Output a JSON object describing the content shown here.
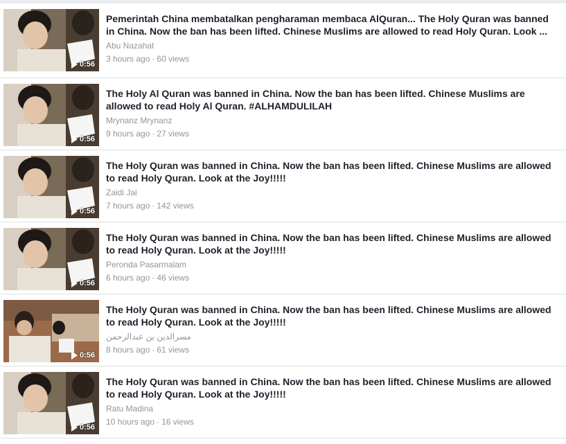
{
  "videos": [
    {
      "title": "Pemerintah China membatalkan pengharaman membaca AlQuran... The Holy Quran was banned in China. Now the ban has been lifted. Chinese Muslims are allowed to read Holy Quran. Look ...",
      "author": "Abu Nazahat",
      "time": "3 hours ago",
      "views": "60 views",
      "duration": "0:56",
      "thumb_variant": "a"
    },
    {
      "title": "The Holy Al Quran was banned in China. Now the ban has been lifted. Chinese Muslims are allowed to read Holy Al Quran. #ALHAMDULILAH",
      "author": "Mrynanz Mrynanz",
      "time": "9 hours ago",
      "views": "27 views",
      "duration": "0:56",
      "thumb_variant": "a"
    },
    {
      "title": "The Holy Quran was banned in China. Now the ban has been lifted. Chinese Muslims are allowed to read Holy Quran. Look at the Joy!!!!!",
      "author": "Zaidi Jai",
      "time": "7 hours ago",
      "views": "142 views",
      "duration": "0:56",
      "thumb_variant": "a"
    },
    {
      "title": "The Holy Quran was banned in China. Now the ban has been lifted. Chinese Muslims are allowed to read Holy Quran. Look at the Joy!!!!!",
      "author": "Peronda Pasarmalam",
      "time": "6 hours ago",
      "views": "46 views",
      "duration": "0:56",
      "thumb_variant": "a"
    },
    {
      "title": "The Holy Quran was banned in China. Now the ban has been lifted. Chinese Muslims are allowed to read Holy Quran. Look at the Joy!!!!!",
      "author": "مسرالدين بن عبدالرحمن",
      "time": "8 hours ago",
      "views": "61 views",
      "duration": "0:56",
      "thumb_variant": "b"
    },
    {
      "title": "The Holy Quran was banned in China. Now the ban has been lifted. Chinese Muslims are allowed to read Holy Quran. Look at the Joy!!!!!",
      "author": "Ratu Madina",
      "time": "10 hours ago",
      "views": "16 views",
      "duration": "0:56",
      "thumb_variant": "a"
    }
  ],
  "separator": "·",
  "icons": {
    "play": "play-icon"
  },
  "colors": {
    "title": "#1d2129",
    "meta": "#90949c",
    "divider": "#dddfe2"
  }
}
